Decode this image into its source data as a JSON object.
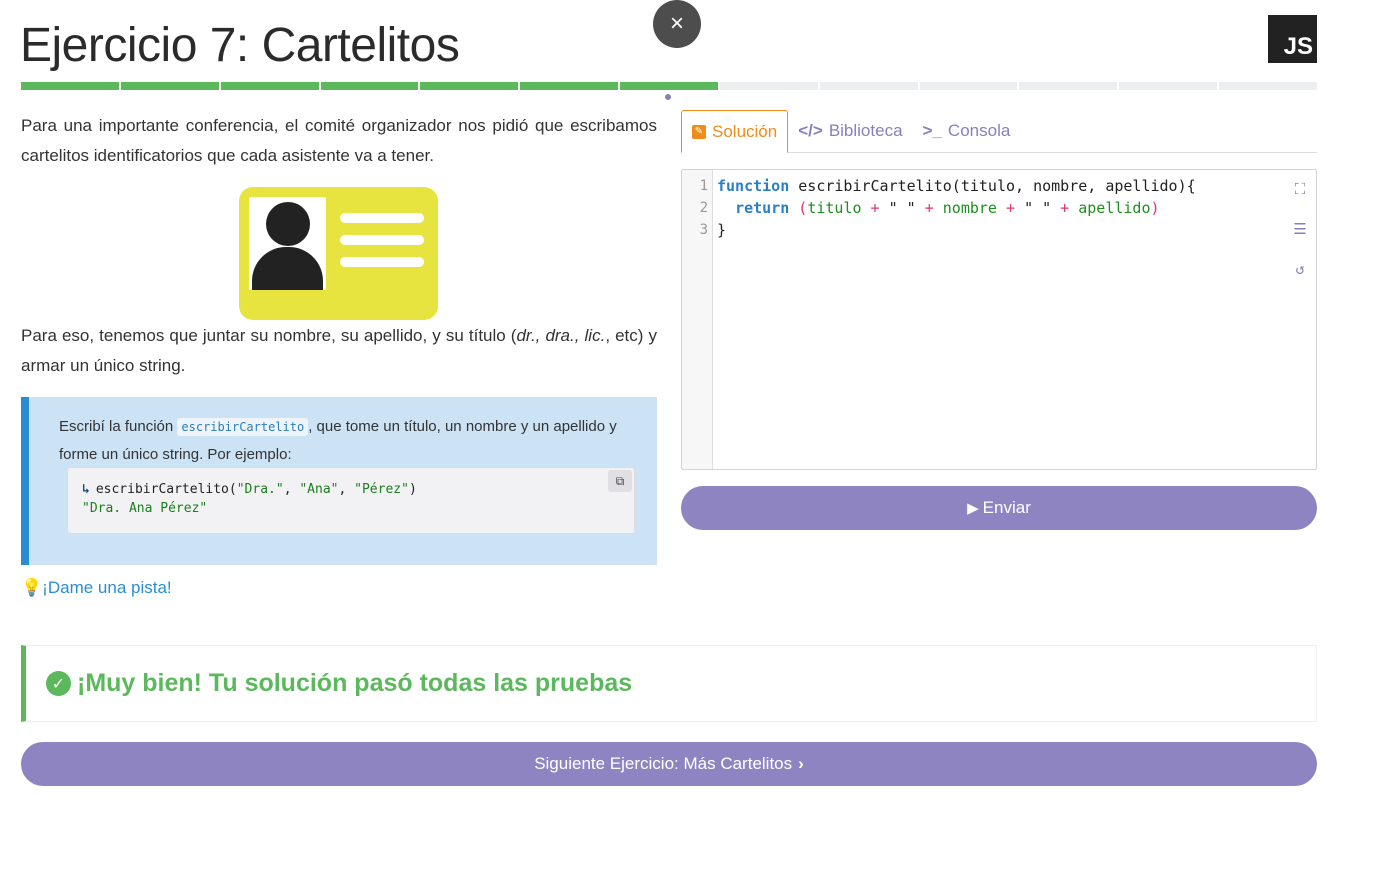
{
  "header": {
    "title": "Ejercicio 7: Cartelitos",
    "close_symbol": "×",
    "logo_text": "JS"
  },
  "progress": {
    "completed": 7,
    "total": 13
  },
  "description": {
    "paragraph1": "Para una importante conferencia, el comité organizador nos pidió que escribamos cartelitos identificatorios que cada asistente va a tener.",
    "paragraph2_start": "Para eso, tenemos que juntar su nombre, su apellido, y su título (",
    "paragraph2_italics": "dr., dra., lic.",
    "paragraph2_end": ", etc) y armar un único string."
  },
  "task": {
    "text_before": "Escribí la función ",
    "function_name": "escribirCartelito",
    "text_after": ", que tome un título, un nombre y un apellido y forme un único string. Por ejemplo:",
    "example": {
      "call_fn": "escribirCartelito(",
      "arg1": "\"Dra.\"",
      "arg2": "\"Ana\"",
      "arg3": "\"Pérez\"",
      "sep": ", ",
      "close": ")",
      "result": "\"Dra. Ana Pérez\""
    }
  },
  "hint": {
    "label": "¡Dame una pista!"
  },
  "tabs": [
    {
      "label": "Solución",
      "icon": "edit-icon"
    },
    {
      "label": "Biblioteca",
      "icon": "code-icon"
    },
    {
      "label": "Consola",
      "icon": "terminal-icon"
    }
  ],
  "editor": {
    "line_numbers": [
      "1",
      "2",
      "3"
    ],
    "line1": {
      "kw": "function",
      "rest": " escribirCartelito(titulo, nombre, apellido){"
    },
    "line2": {
      "indent": "  ",
      "kw": "return",
      "sp": " ",
      "p1": "(",
      "a": "titulo",
      "plus": " + ",
      "s1": "\" \"",
      "plus2": " + ",
      "b": "nombre",
      "plus3": " + ",
      "s2": "\" \"",
      "plus4": " + ",
      "c": "apellido",
      "p2": ")"
    },
    "line3": "}"
  },
  "buttons": {
    "submit": "Enviar",
    "next": "Siguiente Ejercicio: Más Cartelitos"
  },
  "result": {
    "message": "¡Muy bien! Tu solución pasó todas las pruebas"
  },
  "colors": {
    "success": "#5cb85c",
    "accent": "#8f84c2",
    "active_tab": "#f08c1a",
    "info_border": "#2a8dd4"
  }
}
